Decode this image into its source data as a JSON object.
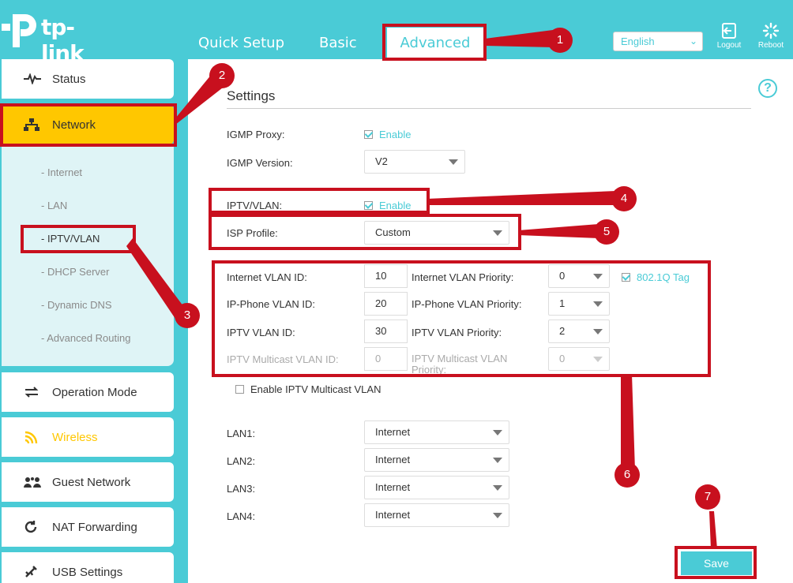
{
  "brand": {
    "name": "tp-link"
  },
  "topnav": {
    "quick_setup": "Quick Setup",
    "basic": "Basic",
    "advanced": "Advanced"
  },
  "header": {
    "language": "English",
    "logout": "Logout",
    "reboot": "Reboot"
  },
  "sidebar": {
    "status": "Status",
    "network": "Network",
    "sub": [
      "Internet",
      "LAN",
      "IPTV/VLAN",
      "DHCP Server",
      "Dynamic DNS",
      "Advanced Routing"
    ],
    "operation_mode": "Operation Mode",
    "wireless": "Wireless",
    "guest_network": "Guest Network",
    "nat_forwarding": "NAT Forwarding",
    "usb_settings": "USB Settings"
  },
  "main": {
    "title": "Settings",
    "help": "?",
    "igmp_proxy_label": "IGMP Proxy:",
    "igmp_proxy_enable": "Enable",
    "igmp_version_label": "IGMP Version:",
    "igmp_version": "V2",
    "iptv_vlan_label": "IPTV/VLAN:",
    "iptv_vlan_enable": "Enable",
    "isp_profile_label": "ISP Profile:",
    "isp_profile": "Custom",
    "internet_vlan_id_label": "Internet VLAN ID:",
    "internet_vlan_id": "10",
    "internet_vlan_priority_label": "Internet VLAN Priority:",
    "internet_vlan_priority": "0",
    "tag_8021q": "802.1Q Tag",
    "ipphone_vlan_id_label": "IP-Phone VLAN ID:",
    "ipphone_vlan_id": "20",
    "ipphone_vlan_priority_label": "IP-Phone VLAN Priority:",
    "ipphone_vlan_priority": "1",
    "iptv_vlan_id_label": "IPTV VLAN ID:",
    "iptv_vlan_id": "30",
    "iptv_vlan_priority_label": "IPTV VLAN Priority:",
    "iptv_vlan_priority": "2",
    "iptv_mc_vlan_id_label": "IPTV Multicast VLAN ID:",
    "iptv_mc_vlan_id": "0",
    "iptv_mc_vlan_priority_label": "IPTV Multicast VLAN Priority:",
    "iptv_mc_vlan_priority": "0",
    "enable_mc_vlan": "Enable IPTV Multicast VLAN",
    "lan1_label": "LAN1:",
    "lan1": "Internet",
    "lan2_label": "LAN2:",
    "lan2": "Internet",
    "lan3_label": "LAN3:",
    "lan3": "Internet",
    "lan4_label": "LAN4:",
    "lan4": "Internet",
    "save": "Save"
  },
  "annotations": [
    "1",
    "2",
    "3",
    "4",
    "5",
    "6",
    "7"
  ],
  "colors": {
    "accent": "#4acbd6",
    "active": "#ffc700",
    "annotation": "#c8101e"
  }
}
